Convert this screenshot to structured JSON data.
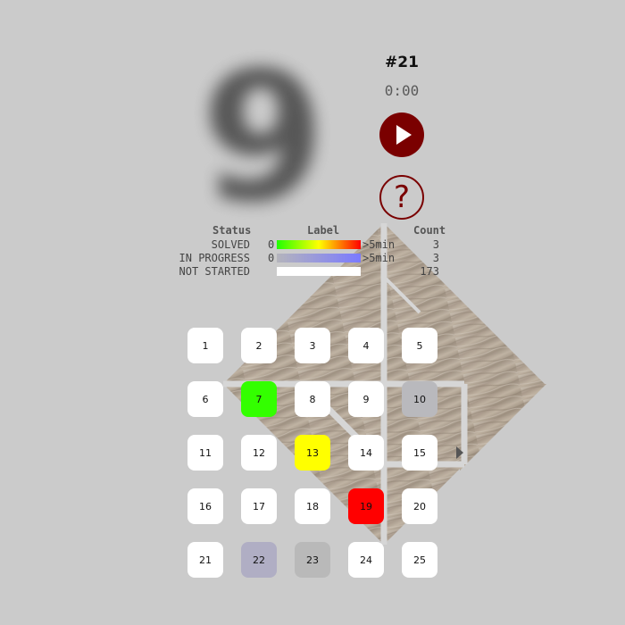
{
  "puzzle": {
    "number": "#21",
    "timer": "0:00",
    "preview_digit": "9"
  },
  "controls": {
    "play_icon": "play-icon",
    "help_icon": "help-icon",
    "help_glyph": "?"
  },
  "legend": {
    "headers": {
      "status": "Status",
      "label": "Label",
      "count": "Count"
    },
    "rows": [
      {
        "status": "SOLVED",
        "min": "0",
        "max": ">5min",
        "count": "3",
        "gradient": [
          "#22ff00",
          "#ffff00",
          "#ff0000"
        ]
      },
      {
        "status": "IN PROGRESS",
        "min": "0",
        "max": ">5min",
        "count": "3",
        "gradient": [
          "#b4b4bc",
          "#7a7aff"
        ]
      },
      {
        "status": "NOT STARTED",
        "min": "",
        "max": "",
        "count": "173",
        "gradient": [
          "#ffffff",
          "#ffffff"
        ]
      }
    ]
  },
  "levels": [
    {
      "label": "1",
      "color": "#ffffff"
    },
    {
      "label": "2",
      "color": "#ffffff"
    },
    {
      "label": "3",
      "color": "#ffffff"
    },
    {
      "label": "4",
      "color": "#ffffff"
    },
    {
      "label": "5",
      "color": "#ffffff"
    },
    {
      "label": "6",
      "color": "#ffffff"
    },
    {
      "label": "7",
      "color": "#33ff00"
    },
    {
      "label": "8",
      "color": "#ffffff"
    },
    {
      "label": "9",
      "color": "#ffffff"
    },
    {
      "label": "10",
      "color": "#b9b9bd"
    },
    {
      "label": "11",
      "color": "#ffffff"
    },
    {
      "label": "12",
      "color": "#ffffff"
    },
    {
      "label": "13",
      "color": "#ffff00"
    },
    {
      "label": "14",
      "color": "#ffffff"
    },
    {
      "label": "15",
      "color": "#ffffff"
    },
    {
      "label": "16",
      "color": "#ffffff"
    },
    {
      "label": "17",
      "color": "#ffffff"
    },
    {
      "label": "18",
      "color": "#ffffff"
    },
    {
      "label": "19",
      "color": "#ff0000"
    },
    {
      "label": "20",
      "color": "#ffffff"
    },
    {
      "label": "21",
      "color": "#ffffff"
    },
    {
      "label": "22",
      "color": "#b0aec4"
    },
    {
      "label": "23",
      "color": "#b9b9b9"
    },
    {
      "label": "24",
      "color": "#ffffff"
    },
    {
      "label": "25",
      "color": "#ffffff"
    }
  ],
  "pager": {
    "next_icon": "next-page-icon"
  }
}
